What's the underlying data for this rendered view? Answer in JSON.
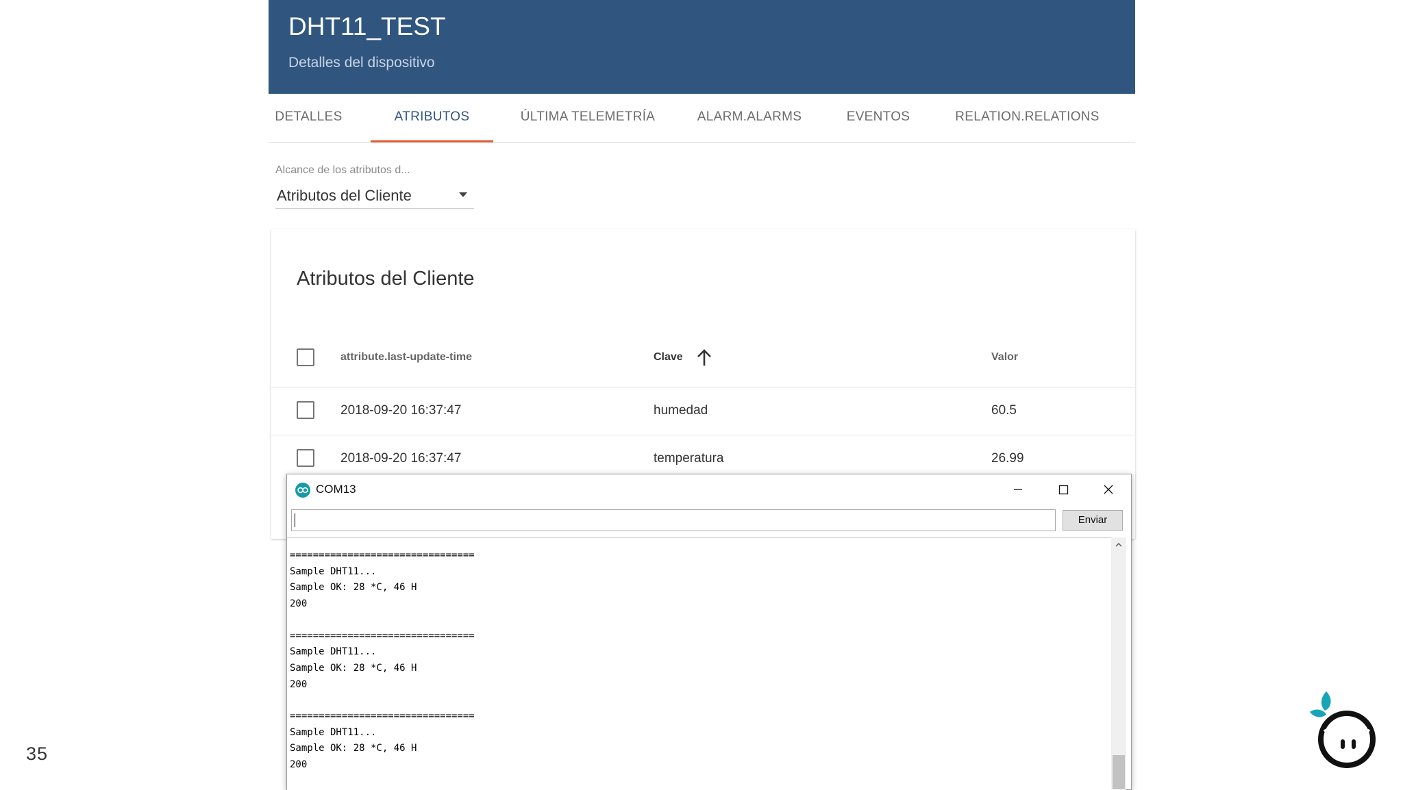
{
  "header": {
    "title": "DHT11_TEST",
    "subtitle": "Detalles del dispositivo"
  },
  "tabs": [
    {
      "label": "DETALLES",
      "active": false
    },
    {
      "label": "ATRIBUTOS",
      "active": true
    },
    {
      "label": "ÚLTIMA TELEMETRÍA",
      "active": false
    },
    {
      "label": "ALARM.ALARMS",
      "active": false
    },
    {
      "label": "EVENTOS",
      "active": false
    },
    {
      "label": "RELATION.RELATIONS",
      "active": false
    }
  ],
  "scope": {
    "label": "Alcance de los atributos d...",
    "value": "Atributos del Cliente"
  },
  "attributes_card": {
    "title": "Atributos del Cliente",
    "columns": {
      "time": "attribute.last-update-time",
      "key": "Clave",
      "value": "Valor"
    },
    "rows": [
      {
        "time": "2018-09-20 16:37:47",
        "key": "humedad",
        "value": "60.5"
      },
      {
        "time": "2018-09-20 16:37:47",
        "key": "temperatura",
        "value": "26.99"
      }
    ]
  },
  "serial_monitor": {
    "title": "COM13",
    "input_value": "",
    "send_label": "Enviar",
    "output_lines": [
      "================================",
      "Sample DHT11...",
      "Sample OK: 28 *C, 46 H",
      "200",
      "",
      "================================",
      "Sample DHT11...",
      "Sample OK: 28 *C, 46 H",
      "200",
      "",
      "================================",
      "Sample DHT11...",
      "Sample OK: 28 *C, 46 H",
      "200"
    ]
  },
  "slide_number": "35",
  "colors": {
    "header_bg": "#305680",
    "tab_indicator": "#e65f33",
    "logo_teal": "#17a5b8"
  }
}
